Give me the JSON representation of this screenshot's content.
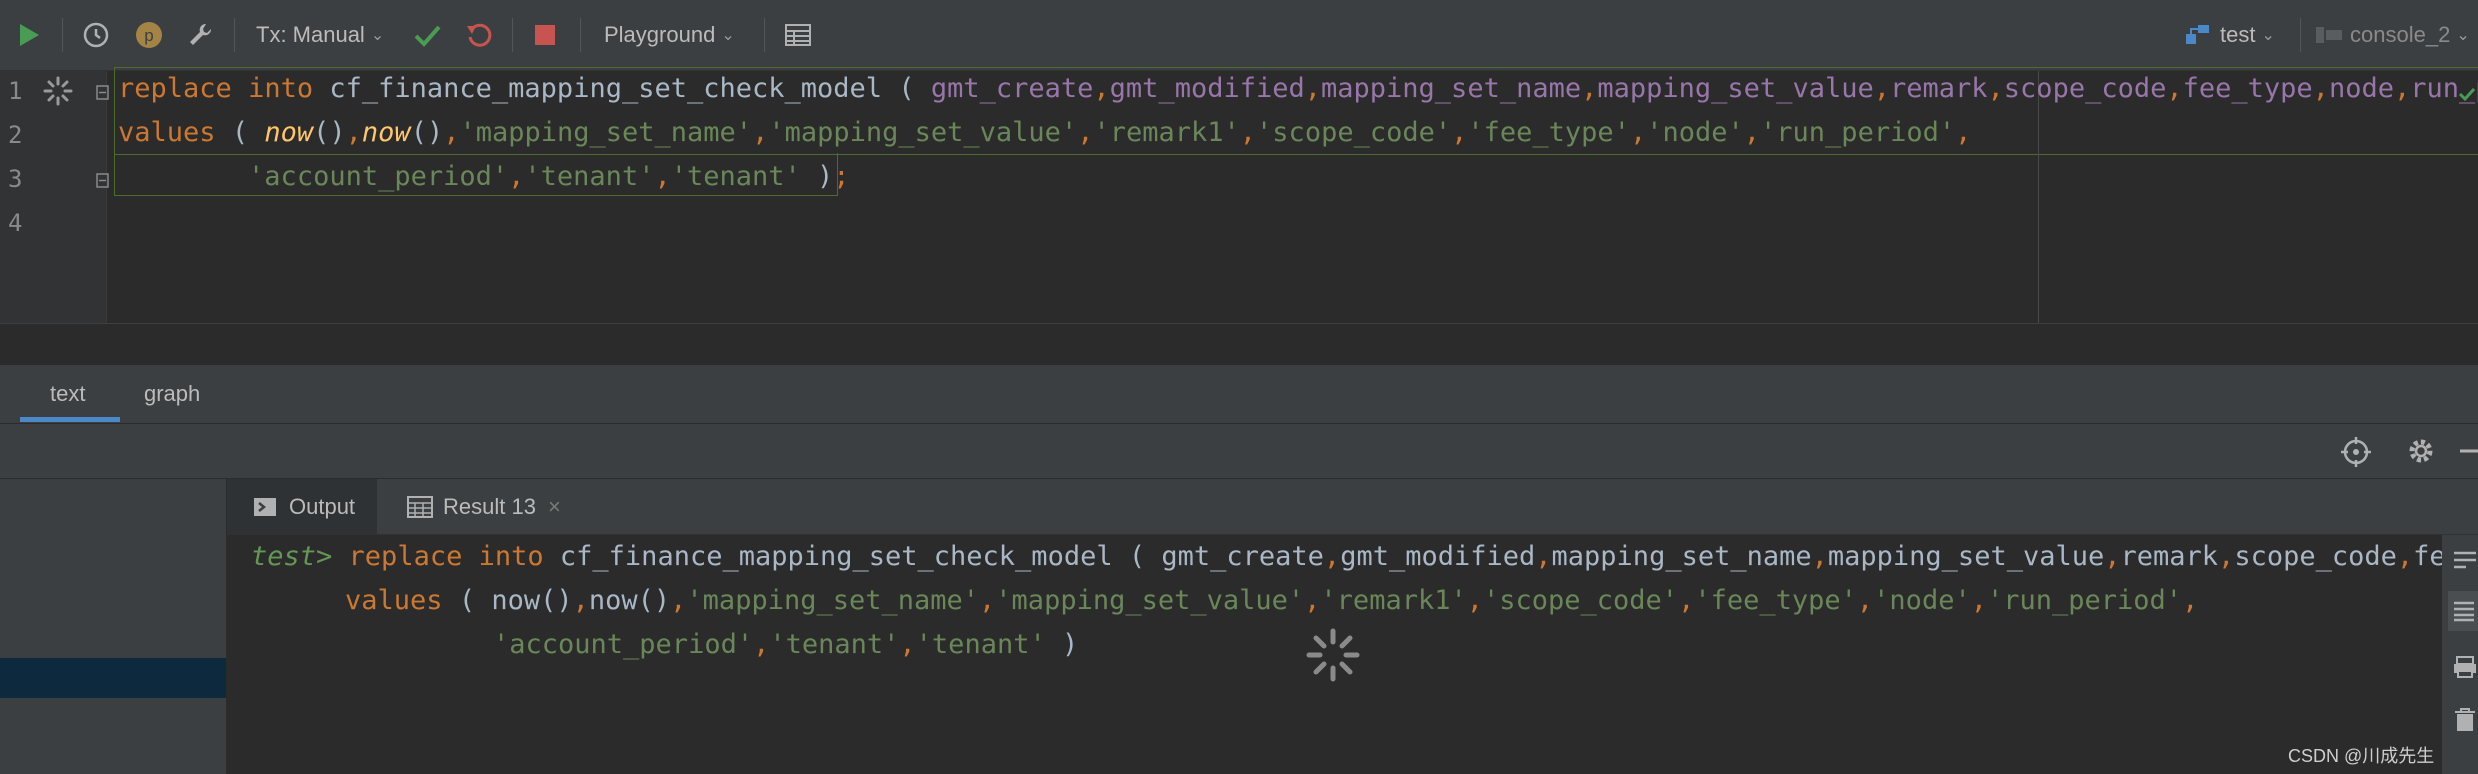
{
  "toolbar": {
    "tx_mode": "Tx: Manual",
    "playground": "Playground",
    "datasource": "test",
    "console": "console_2"
  },
  "editor": {
    "line_numbers": [
      "1",
      "2",
      "3",
      "4"
    ],
    "line1": {
      "kw1": "replace",
      "kw2": "into",
      "table": "cf_finance_mapping_set_check_model",
      "paren": "(",
      "c1": "gmt_create",
      "c2": "gmt_modified",
      "c3": "mapping_set_name",
      "c4": "mapping_set_value",
      "c5": "remark",
      "c6": "scope_code",
      "c7": "fee_type",
      "c8": "node",
      "c9": "run_p"
    },
    "line2": {
      "kw": "values",
      "paren": "(",
      "fn1": "now",
      "fn2": "now",
      "s1": "'mapping_set_name'",
      "s2": "'mapping_set_value'",
      "s3": "'remark1'",
      "s4": "'scope_code'",
      "s5": "'fee_type'",
      "s6": "'node'",
      "s7": "'run_period'"
    },
    "line3": {
      "s1": "'account_period'",
      "s2": "'tenant'",
      "s3": "'tenant'",
      "close": ")",
      "semi": ";"
    }
  },
  "view_tabs": [
    "text",
    "graph"
  ],
  "output_tabs": {
    "output": "Output",
    "result": "Result 13"
  },
  "console": {
    "prompt": "test>",
    "line1": {
      "kw1": "replace",
      "kw2": "into",
      "rest": "cf_finance_mapping_set_check_model ( gmt_create",
      "c2": "gmt_modified",
      "c3": "mapping_set_name",
      "c4": "mapping_set_value",
      "c5": "remark",
      "c6": "scope_code",
      "c7": "fee_"
    },
    "line2": {
      "kw": "values",
      "a": "( now()",
      "b": "now()",
      "s1": "'mapping_set_name'",
      "s2": "'mapping_set_value'",
      "s3": "'remark1'",
      "s4": "'scope_code'",
      "s5": "'fee_type'",
      "s6": "'node'",
      "s7": "'run_period'"
    },
    "line3": {
      "s1": "'account_period'",
      "s2": "'tenant'",
      "s3": "'tenant'",
      "close": ")"
    }
  },
  "watermark": "CSDN @川成先生",
  "colors": {
    "run_green": "#499c54",
    "stop_red": "#c75450",
    "accent_blue": "#4a88c7",
    "selection": "#0d293e"
  }
}
